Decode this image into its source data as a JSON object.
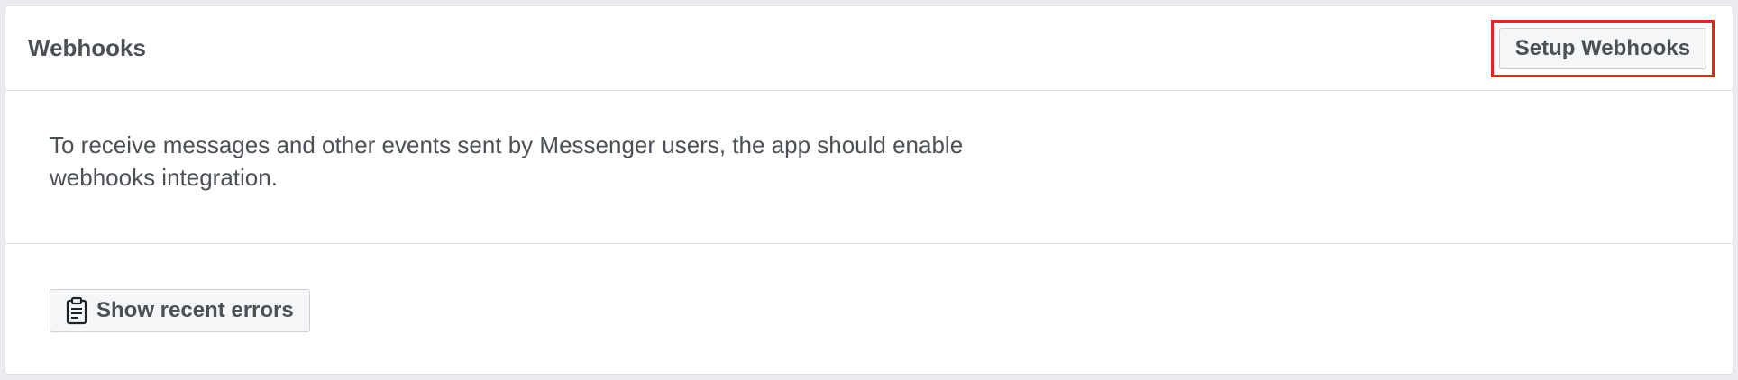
{
  "header": {
    "title": "Webhooks",
    "setup_button_label": "Setup Webhooks"
  },
  "body": {
    "description_line1": "To receive messages and other events sent by Messenger users, the app should enable",
    "description_line2": "webhooks integration."
  },
  "footer": {
    "errors_button_label": "Show recent errors",
    "errors_button_icon": "clipboard-icon"
  },
  "colors": {
    "highlight_border": "#e8231c",
    "text": "#4b4f56",
    "button_bg": "#f5f6f7",
    "divider": "#dddfe2",
    "page_bg": "#e9ebee"
  }
}
